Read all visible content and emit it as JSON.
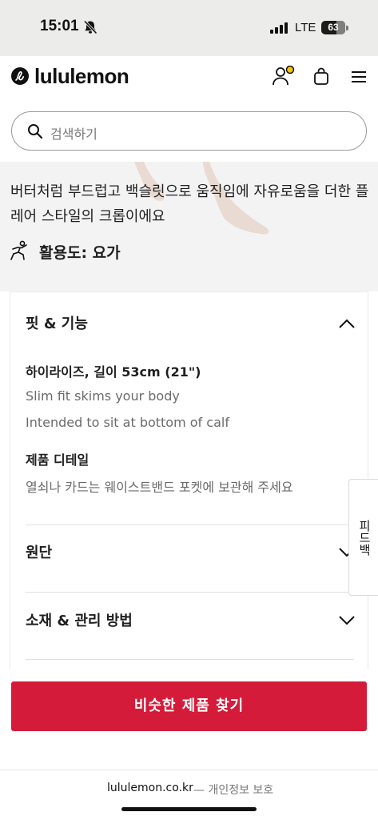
{
  "status_bar": {
    "time": "15:01",
    "network": "LTE",
    "battery": "63",
    "battery_level": 0.63,
    "icons": [
      "bell-off-icon",
      "signal-icon",
      "battery-icon"
    ]
  },
  "header": {
    "brand": "lululemon",
    "icons": [
      "lululemon-logo-icon",
      "account-icon",
      "shopping-bag-icon",
      "hamburger-menu-icon"
    ],
    "account_badge_color": "#f5c400"
  },
  "search": {
    "placeholder": "검색하기"
  },
  "product": {
    "description": "버터처럼 부드럽고 백슬릿으로 움직임에 자유로움을 더한 플레어 스타일의 크롭이에요",
    "activity": "활용도: 요가"
  },
  "accordion": {
    "fit": {
      "title": "핏 & 기능",
      "expanded": true,
      "sections": [
        {
          "heading": "하이라이즈, 길이 53cm (21\")",
          "lines": [
            "Slim fit skims your body",
            "Intended to sit at bottom of calf"
          ]
        },
        {
          "heading": "제품 디테일",
          "lines": [
            "열쇠나 카드는 웨이스트밴드 포켓에 보관해 주세요"
          ]
        }
      ]
    },
    "fabric": {
      "title": "원단",
      "expanded": false
    },
    "care": {
      "title": "소재 & 관리 방법",
      "expanded": false
    }
  },
  "side_tab": {
    "label": "피드백"
  },
  "cta": {
    "label": "비슷한 제품 찾기",
    "color": "#d41c3a"
  },
  "footer": {
    "domain": "lululemon.co.kr",
    "privacy": "— 개인정보 보호"
  }
}
